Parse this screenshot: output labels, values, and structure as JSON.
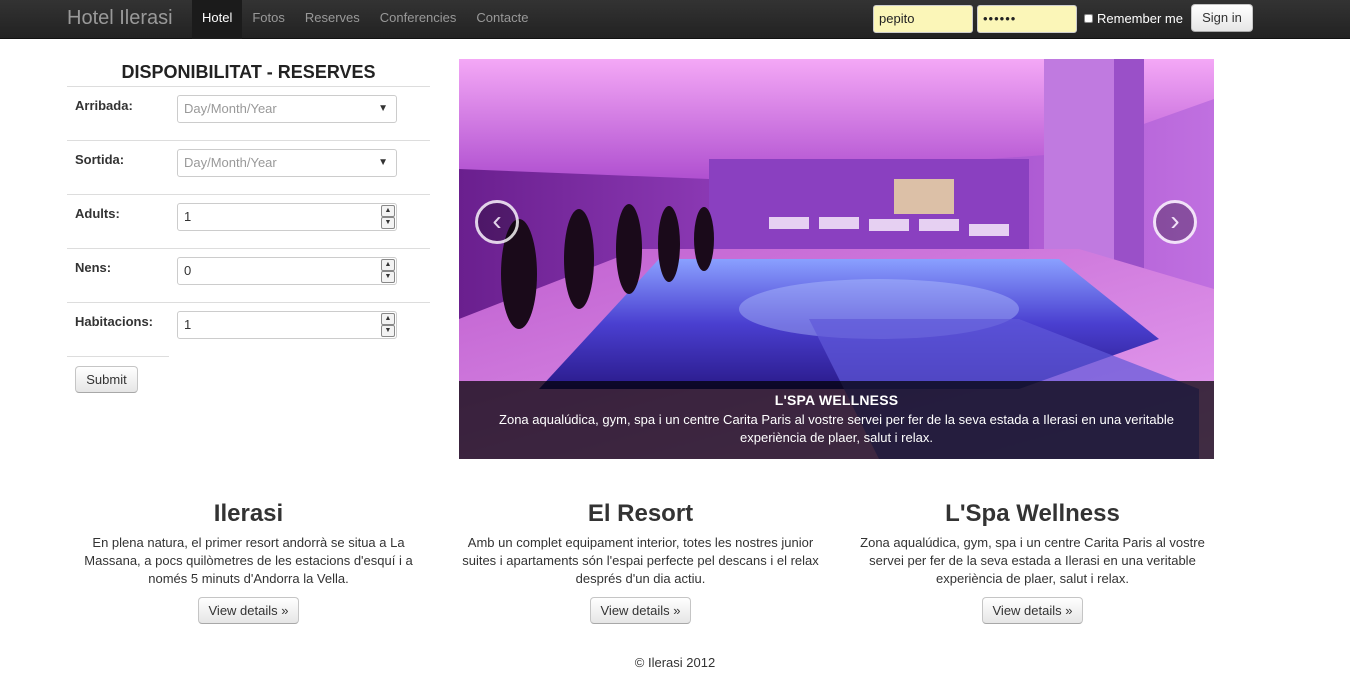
{
  "navbar": {
    "brand": "Hotel Ilerasi",
    "items": [
      {
        "label": "Hotel"
      },
      {
        "label": "Fotos"
      },
      {
        "label": "Reserves"
      },
      {
        "label": "Conferencies"
      },
      {
        "label": "Contacte"
      }
    ],
    "active_index": 0,
    "username_value": "pepito",
    "password_value": "••••••",
    "remember_label": "Remember me",
    "signin_label": "Sign in"
  },
  "booking": {
    "title": "DISPONIBILITAT - RESERVES",
    "arrival": {
      "label": "Arribada:",
      "placeholder": "Day/Month/Year"
    },
    "departure": {
      "label": "Sortida:",
      "placeholder": "Day/Month/Year"
    },
    "adults": {
      "label": "Adults:",
      "value": "1"
    },
    "children": {
      "label": "Nens:",
      "value": "0"
    },
    "rooms": {
      "label": "Habitacions:",
      "value": "1"
    },
    "submit_label": "Submit"
  },
  "carousel": {
    "prev_glyph": "‹",
    "next_glyph": "›",
    "caption_title": "L'SPA WELLNESS",
    "caption_text": "Zona aqualúdica, gym, spa i un centre Carita Paris al vostre servei per fer de la seva estada a Ilerasi en una veritable experiència de plaer, salut i relax."
  },
  "features": [
    {
      "title": "Ilerasi",
      "text": "En plena natura, el primer resort andorrà se situa a La Massana, a pocs quilòmetres de les estacions d'esquí i a només 5 minuts d'Andorra la Vella.",
      "button": "View details »"
    },
    {
      "title": "El Resort",
      "text": "Amb un complet equipament interior, totes les nostres junior suites i apartaments són l'espai perfecte pel descans i el relax després d'un dia actiu.",
      "button": "View details »"
    },
    {
      "title": "L'Spa Wellness",
      "text": "Zona aqualúdica, gym, spa i un centre Carita Paris al vostre servei per fer de la seva estada a Ilerasi en una veritable experiència de plaer, salut i relax.",
      "button": "View details »"
    }
  ],
  "footer": "© Ilerasi 2012"
}
